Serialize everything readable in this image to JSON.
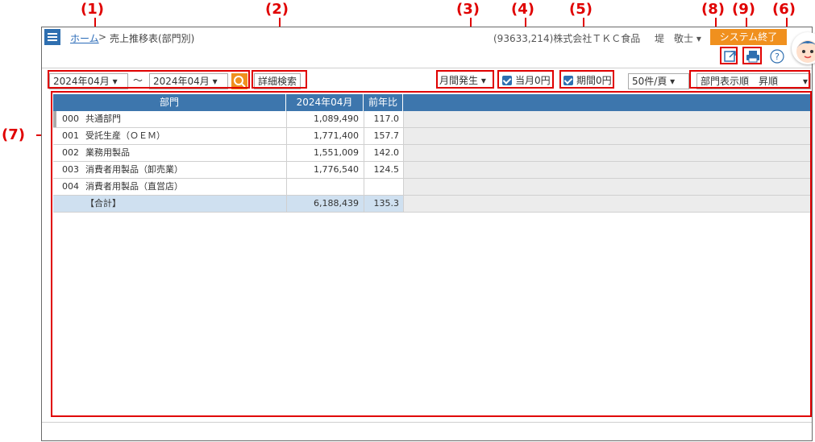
{
  "callouts": {
    "c1": "(1)",
    "c2": "(2)",
    "c3": "(3)",
    "c4": "(4)",
    "c5": "(5)",
    "c6": "(6)",
    "c7": "(7)",
    "c8": "(8)",
    "c9": "(9)"
  },
  "header": {
    "home": "ホーム",
    "separator": ">",
    "page_title": "売上推移表(部門別)",
    "company": "(93633,214)株式会社ＴＫＣ食品",
    "user": "堤　敬士 ▾",
    "exit_label": "システム終了"
  },
  "icons": {
    "export": "export-icon",
    "print": "print-icon",
    "help": "help-icon"
  },
  "toolbar": {
    "date_from": "2024年04月",
    "range_sep": "〜",
    "date_to": "2024年04月",
    "detail_search": "詳細検索",
    "period_type": "月間発生",
    "month_zero": "当月0円",
    "period_zero": "期間0円",
    "page_size": "50件/頁",
    "sort_order": "部門表示順　昇順"
  },
  "colors": {
    "accent_blue": "#3d76ad",
    "orange": "#f0901e",
    "callout_red": "#e00000"
  },
  "table": {
    "headers": [
      "部門",
      "2024年04月",
      "前年比"
    ],
    "rows": [
      {
        "code": "000",
        "name": "共通部門",
        "value": "1,089,490",
        "ratio": "117.0"
      },
      {
        "code": "001",
        "name": "受託生産（ＯＥＭ）",
        "value": "1,771,400",
        "ratio": "157.7"
      },
      {
        "code": "002",
        "name": "業務用製品",
        "value": "1,551,009",
        "ratio": "142.0"
      },
      {
        "code": "003",
        "name": "消費者用製品（卸売業）",
        "value": "1,776,540",
        "ratio": "124.5"
      },
      {
        "code": "004",
        "name": "消費者用製品（直営店）",
        "value": "",
        "ratio": ""
      }
    ],
    "total": {
      "name": "【合計】",
      "value": "6,188,439",
      "ratio": "135.3"
    }
  }
}
